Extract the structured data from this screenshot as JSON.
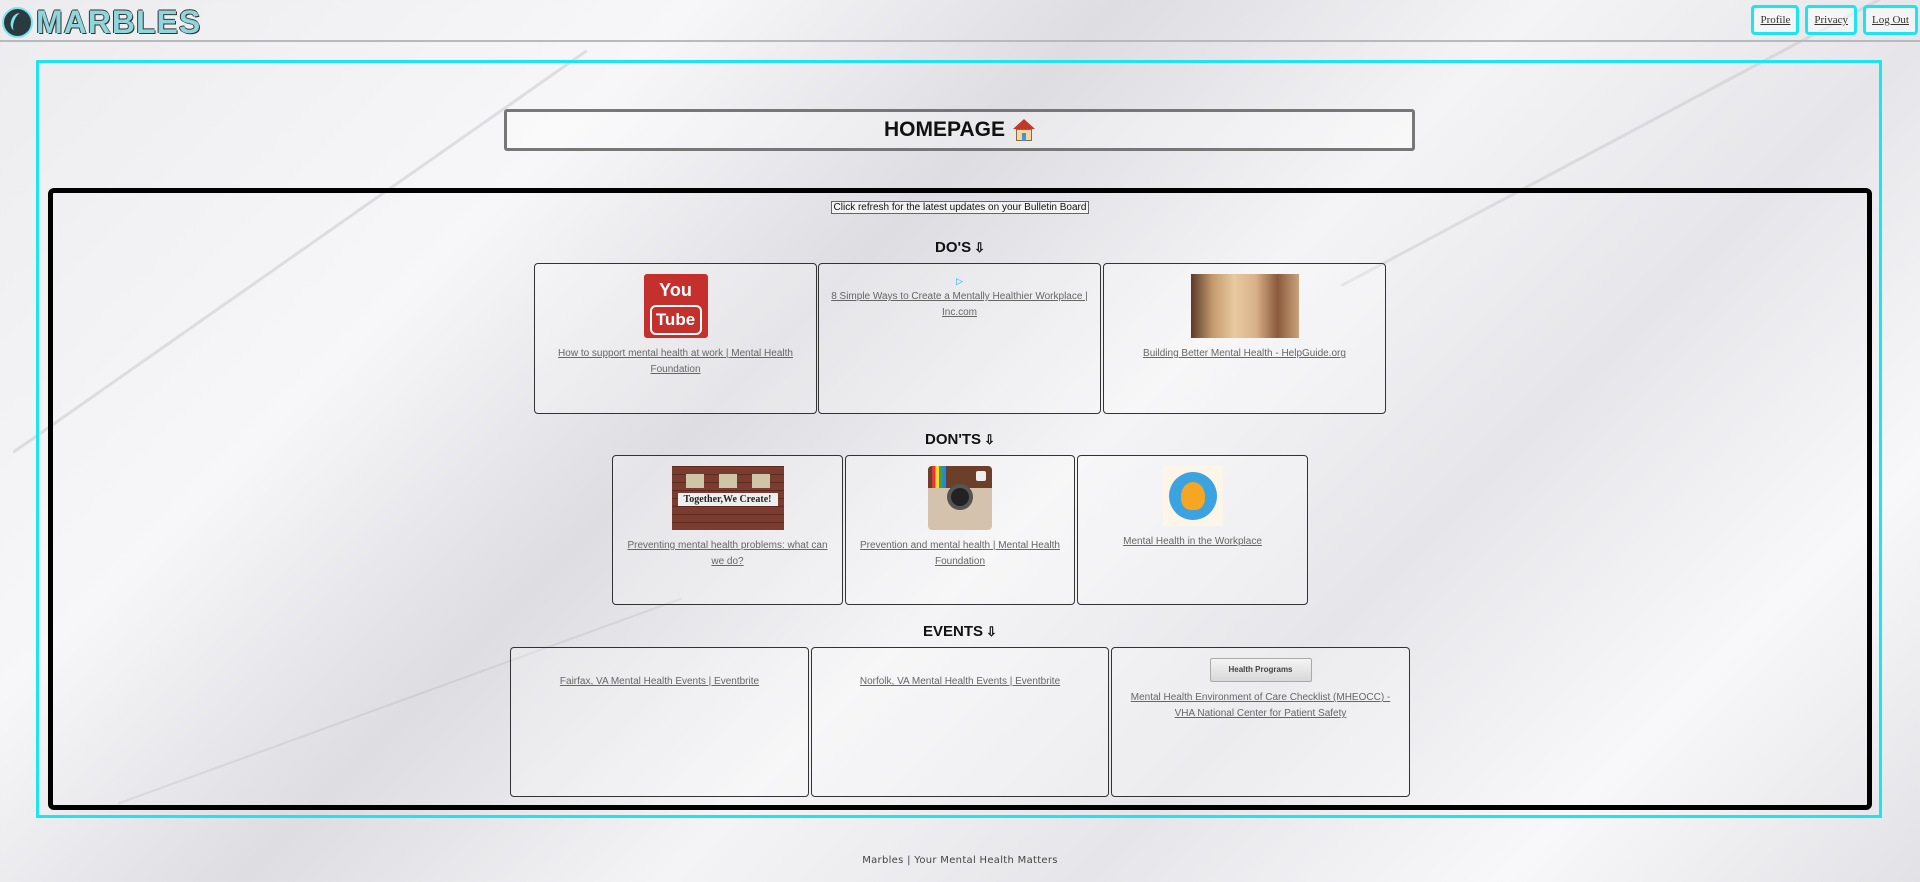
{
  "header": {
    "logo_text": "MARBLES",
    "nav": [
      "Profile",
      "Privacy",
      "Log Out"
    ]
  },
  "page_title": "HOMEPAGE",
  "refresh_notice": "Click refresh for the latest updates on your Bulletin Board",
  "sections": {
    "dos": {
      "title": "DO'S",
      "items": [
        {
          "label": "How to support mental health at work | Mental Health Foundation",
          "thumb": "youtube-logo"
        },
        {
          "label": "8 Simple Ways to Create a Mentally Healthier Workplace | Inc.com",
          "thumb": "play-icon"
        },
        {
          "label": "Building Better Mental Health - HelpGuide.org",
          "thumb": "people-photo"
        }
      ]
    },
    "donts": {
      "title": "DON'TS",
      "items": [
        {
          "label": "Preventing mental health problems: what can we do?",
          "thumb": "together-we-create-photo",
          "sign": "Together,We Create!"
        },
        {
          "label": "Prevention and mental health | Mental Health Foundation",
          "thumb": "instagram-logo"
        },
        {
          "label": "Mental Health in the Workplace",
          "thumb": "gear-head-icon"
        }
      ]
    },
    "events": {
      "title": "EVENTS",
      "items": [
        {
          "label": "Fairfax, VA Mental Health Events | Eventbrite"
        },
        {
          "label": "Norfolk, VA Mental Health Events | Eventbrite"
        },
        {
          "label": "Mental Health Environment of Care Checklist (MHEOCC) - VHA National Center for Patient Safety",
          "badge": "Health Programs"
        }
      ]
    }
  },
  "footer": "Marbles | Your Mental Health Matters",
  "colors": {
    "accent": "#19e6f0",
    "board_border": "#000000",
    "link": "#666666"
  }
}
